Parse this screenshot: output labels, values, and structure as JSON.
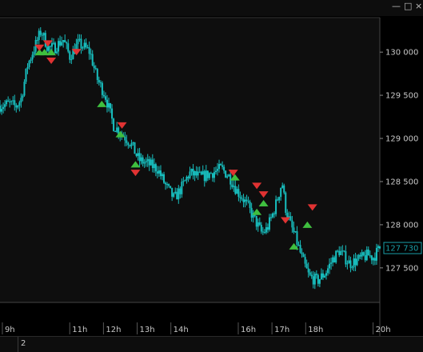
{
  "window": {
    "minimize_label": "—",
    "restore_label": "□",
    "close_label": "×"
  },
  "bottom_bar": {
    "page_number": "2"
  },
  "colors": {
    "background": "#0e0e0e",
    "candle": "#18c0c0",
    "up_marker": "#3fbf3f",
    "down_marker": "#e03232",
    "current_price_box": "#1a9fa8"
  },
  "chart_data": {
    "type": "candlestick",
    "y_ticks": [
      127500,
      128000,
      128500,
      129000,
      129500,
      130000
    ],
    "y_tick_labels": [
      "127 500",
      "128 000",
      "128 500",
      "129 000",
      "129 500",
      "130 000"
    ],
    "ylim": [
      127100,
      130400
    ],
    "x_ticks": [
      9,
      11,
      12,
      13,
      14,
      16,
      17,
      18,
      20
    ],
    "x_tick_labels": [
      "9h",
      "11h",
      "12h",
      "13h",
      "14h",
      "16h",
      "17h",
      "18h",
      "20h"
    ],
    "xlim": [
      8.93,
      20.2
    ],
    "current_price": 127730,
    "current_price_label": "127 730",
    "price_path": [
      [
        8.93,
        129380
      ],
      [
        9.2,
        129400
      ],
      [
        9.4,
        129370
      ],
      [
        9.55,
        129450
      ],
      [
        9.75,
        129850
      ],
      [
        10.0,
        130100
      ],
      [
        10.15,
        130250
      ],
      [
        10.35,
        130050
      ],
      [
        10.55,
        130050
      ],
      [
        10.8,
        130150
      ],
      [
        11.0,
        129950
      ],
      [
        11.25,
        130100
      ],
      [
        11.45,
        130050
      ],
      [
        11.6,
        130000
      ],
      [
        11.8,
        129700
      ],
      [
        12.05,
        129500
      ],
      [
        12.3,
        129150
      ],
      [
        12.55,
        129050
      ],
      [
        12.8,
        128950
      ],
      [
        13.05,
        128750
      ],
      [
        13.35,
        128700
      ],
      [
        13.6,
        128650
      ],
      [
        13.85,
        128450
      ],
      [
        14.1,
        128300
      ],
      [
        14.35,
        128450
      ],
      [
        14.55,
        128600
      ],
      [
        14.9,
        128550
      ],
      [
        15.2,
        128600
      ],
      [
        15.5,
        128650
      ],
      [
        15.75,
        128550
      ],
      [
        15.95,
        128400
      ],
      [
        16.15,
        128300
      ],
      [
        16.3,
        128200
      ],
      [
        16.5,
        128050
      ],
      [
        16.7,
        127900
      ],
      [
        16.85,
        127950
      ],
      [
        16.95,
        128050
      ],
      [
        17.05,
        128150
      ],
      [
        17.2,
        128350
      ],
      [
        17.3,
        128500
      ],
      [
        17.4,
        128200
      ],
      [
        17.55,
        128000
      ],
      [
        17.7,
        127850
      ],
      [
        17.9,
        127600
      ],
      [
        18.1,
        127400
      ],
      [
        18.35,
        127350
      ],
      [
        18.6,
        127450
      ],
      [
        18.8,
        127600
      ],
      [
        19.0,
        127700
      ],
      [
        19.3,
        127550
      ],
      [
        19.6,
        127600
      ],
      [
        19.85,
        127650
      ],
      [
        20.0,
        127620
      ],
      [
        20.2,
        127730
      ]
    ],
    "buy_signals": [
      [
        10.1,
        130000
      ],
      [
        10.25,
        130000
      ],
      [
        10.45,
        130000
      ],
      [
        11.95,
        129400
      ],
      [
        12.5,
        129050
      ],
      [
        12.95,
        128700
      ],
      [
        15.9,
        128550
      ],
      [
        16.55,
        128150
      ],
      [
        16.75,
        128250
      ],
      [
        17.65,
        127750
      ],
      [
        18.05,
        128000
      ]
    ],
    "sell_signals": [
      [
        10.1,
        130050
      ],
      [
        10.35,
        130100
      ],
      [
        10.45,
        129900
      ],
      [
        11.2,
        130000
      ],
      [
        12.55,
        129150
      ],
      [
        12.95,
        128600
      ],
      [
        15.85,
        128600
      ],
      [
        16.55,
        128450
      ],
      [
        16.75,
        128350
      ],
      [
        17.4,
        128050
      ],
      [
        18.2,
        128200
      ]
    ]
  }
}
